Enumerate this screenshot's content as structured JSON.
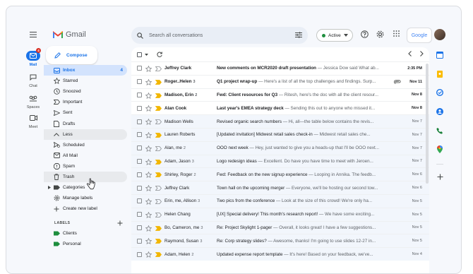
{
  "app": {
    "logo_text": "Gmail",
    "compose_label": "Compose"
  },
  "rail": [
    {
      "id": "mail",
      "label": "Mail",
      "badge": "4"
    },
    {
      "id": "chat",
      "label": "Chat"
    },
    {
      "id": "spaces",
      "label": "Spaces"
    },
    {
      "id": "meet",
      "label": "Meet"
    }
  ],
  "sidebar": {
    "items": [
      {
        "label": "Inbox",
        "count": "4",
        "icon": "inbox-icon"
      },
      {
        "label": "Starred",
        "icon": "star-icon"
      },
      {
        "label": "Snoozed",
        "icon": "clock-icon"
      },
      {
        "label": "Important",
        "icon": "important-icon"
      },
      {
        "label": "Sent",
        "icon": "send-icon"
      },
      {
        "label": "Drafts",
        "icon": "draft-icon"
      },
      {
        "label": "Less",
        "icon": "chevron-up-icon"
      },
      {
        "label": "Scheduled",
        "icon": "schedule-send-icon"
      },
      {
        "label": "All Mail",
        "icon": "all-mail-icon"
      },
      {
        "label": "Spam",
        "icon": "spam-icon"
      },
      {
        "label": "Trash",
        "icon": "trash-icon"
      },
      {
        "label": "Categories",
        "icon": "label-icon"
      },
      {
        "label": "Manage labels",
        "icon": "gear-icon"
      },
      {
        "label": "Create new label",
        "icon": "plus-icon"
      }
    ],
    "labels_heading": "LABELS",
    "labels": [
      {
        "label": "Clients",
        "color": "#1e8e3e"
      },
      {
        "label": "Personal",
        "color": "#1e8e3e"
      }
    ]
  },
  "search": {
    "placeholder": "Search all conversations"
  },
  "status": {
    "label": "Active",
    "color": "#1e8e3e"
  },
  "account": {
    "google_label": "Google"
  },
  "emails": [
    {
      "sender": "Jeffrey Clark",
      "num": "",
      "subject": "New comments on MCR2020 draft presentation",
      "snippet": " — Jessica Dow said What ab...",
      "date": "2:35 PM",
      "unread": true,
      "important": false,
      "attach": false
    },
    {
      "sender": "Roger..Helen",
      "num": "3",
      "subject": "Q1 project wrap-up",
      "snippet": " — Here's a list of all the top challenges and findings. Surp...",
      "date": "Nov 11",
      "unread": true,
      "important": true,
      "attach": true
    },
    {
      "sender": "Madison, Erin",
      "num": "2",
      "subject": "Fwd: Client resources for Q3",
      "snippet": " — Ritesh, here's the doc with all the client resour...",
      "date": "Nov 8",
      "unread": true,
      "important": true,
      "attach": false
    },
    {
      "sender": "Alan Cook",
      "num": "",
      "subject": "Last year's EMEA strategy deck",
      "snippet": " — Sending this out to anyone who missed it...",
      "date": "Nov 8",
      "unread": true,
      "important": true,
      "attach": false
    },
    {
      "sender": "Madison Wells",
      "num": "",
      "subject": "Revised organic search numbers",
      "snippet": " — Hi, all—the table below contains the revis...",
      "date": "Nov 7",
      "unread": false,
      "important": false,
      "attach": false
    },
    {
      "sender": "Lauren Roberts",
      "num": "",
      "subject": "[Updated invitation] Midwest retail sales check-in",
      "snippet": " — Midwest retail sales che...",
      "date": "Nov 7",
      "unread": false,
      "important": true,
      "attach": false
    },
    {
      "sender": "Alan, me",
      "num": "2",
      "subject": "OOO next week",
      "snippet": " — Hey, just wanted to give you a heads-up that I'll be OOO next...",
      "date": "Nov 7",
      "unread": false,
      "important": false,
      "attach": false
    },
    {
      "sender": "Adam, Jason",
      "num": "3",
      "subject": "Logo redesign ideas",
      "snippet": " — Excellent. Do have you have time to meet with Jeroen...",
      "date": "Nov 7",
      "unread": false,
      "important": true,
      "attach": false
    },
    {
      "sender": "Shirley, Roger",
      "num": "2",
      "subject": "Fwd: Feedback on the new signup experience",
      "snippet": " — Looping in Annika. The feedb...",
      "date": "Nov 6",
      "unread": false,
      "important": true,
      "attach": false
    },
    {
      "sender": "Jeffrey Clark",
      "num": "",
      "subject": "Town hall on the upcoming merger",
      "snippet": " — Everyone, we'll be hosting our second tow...",
      "date": "Nov 6",
      "unread": false,
      "important": false,
      "attach": false
    },
    {
      "sender": "Erin, me, Allison",
      "num": "3",
      "subject": "Two pics from the conference",
      "snippet": " — Look at the size of this crowd! We're only ha...",
      "date": "Nov 5",
      "unread": false,
      "important": false,
      "attach": false
    },
    {
      "sender": "Helen Chang",
      "num": "",
      "subject": "[UX] Special delivery! This month's research report!",
      "snippet": " — We have some exciting...",
      "date": "Nov 5",
      "unread": false,
      "important": false,
      "attach": false
    },
    {
      "sender": "Bo, Cameron, me",
      "num": "3",
      "subject": "Re: Project Skylight 1-pager",
      "snippet": " — Overall, it looks great! I have a few suggestions...",
      "date": "Nov 5",
      "unread": false,
      "important": true,
      "attach": false
    },
    {
      "sender": "Raymond, Susan",
      "num": "3",
      "subject": "Re: Corp strategy slides?",
      "snippet": " — Awesome, thanks! I'm going to use slides 12-27 in...",
      "date": "Nov 5",
      "unread": false,
      "important": true,
      "attach": false
    },
    {
      "sender": "Adam, Helen",
      "num": "2",
      "subject": "Updated expense report template",
      "snippet": " — It's here! Based on your feedback, we've...",
      "date": "Nov 4",
      "unread": false,
      "important": true,
      "attach": false
    }
  ],
  "colors": {
    "accent": "#1a73e8",
    "important": "#f2b600",
    "badge": "#d93025"
  }
}
